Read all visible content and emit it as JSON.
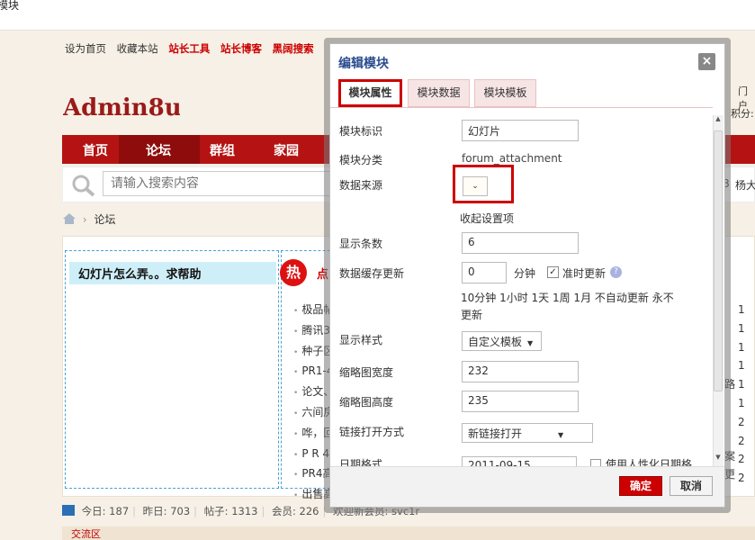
{
  "window": {
    "title": "模块"
  },
  "top_links": [
    "设为首页",
    "收藏本站",
    "站长工具",
    "站长博客",
    "黑阔搜索"
  ],
  "logo": {
    "text": "Admin8us"
  },
  "header_right": {
    "portal": "门户",
    "points": "积分:"
  },
  "nav": [
    "首页",
    "论坛",
    "群组",
    "家园"
  ],
  "search": {
    "placeholder": "请输入搜索内容"
  },
  "right_side": {
    "a": "8",
    "b": "杨大"
  },
  "breadcrumb": {
    "current": "论坛"
  },
  "slide_box": {
    "title": "幻灯片怎么弄。。求帮助"
  },
  "hot": {
    "badge": "热",
    "label": "点",
    "items": [
      "极品帖",
      "腾讯3",
      "种子区",
      "PR1-4",
      "论文、",
      "六间房",
      "哗，回",
      "P R 4",
      "PR4高",
      "出售高"
    ]
  },
  "right_numbers": [
    "1",
    "1",
    "1",
    "1",
    "1",
    "1",
    "2",
    "2",
    "2",
    "2"
  ],
  "right_words": [
    "路",
    "案",
    "更"
  ],
  "stats": {
    "today": "今日: 187",
    "yesterday": "昨日: 703",
    "posts": "帖子: 1313",
    "members": "会员: 226",
    "welcome": "欢迎新会员: svc1r"
  },
  "footer_bar": {
    "label": "交流区"
  },
  "modal": {
    "title": "编辑模块",
    "close": "×",
    "tabs": [
      "模块属性",
      "模块数据",
      "模块模板"
    ],
    "fields": {
      "id_label": "模块标识",
      "id_value": "幻灯片",
      "category_label": "模块分类",
      "category_value": "forum_attachment",
      "source_label": "数据来源",
      "source_value": "",
      "collapse": "收起设置项",
      "count_label": "显示条数",
      "count_value": "6",
      "cache_label": "数据缓存更新",
      "cache_value": "0",
      "cache_unit": "分钟",
      "ontime": "准时更新",
      "cache_options_line1": "10分钟  1小时  1天  1周  1月  不自动更新  永不",
      "cache_options_line2": "更新",
      "style_label": "显示样式",
      "style_value": "自定义模板",
      "thumb_w_label": "缩略图宽度",
      "thumb_w_value": "232",
      "thumb_h_label": "缩略图高度",
      "thumb_h_value": "235",
      "link_label": "链接打开方式",
      "link_value": "新链接打开",
      "date_label": "日期格式",
      "date_value": "2011-09-15",
      "date_personal": "使用人性化日期格"
    },
    "ok": "确定",
    "cancel": "取消"
  }
}
